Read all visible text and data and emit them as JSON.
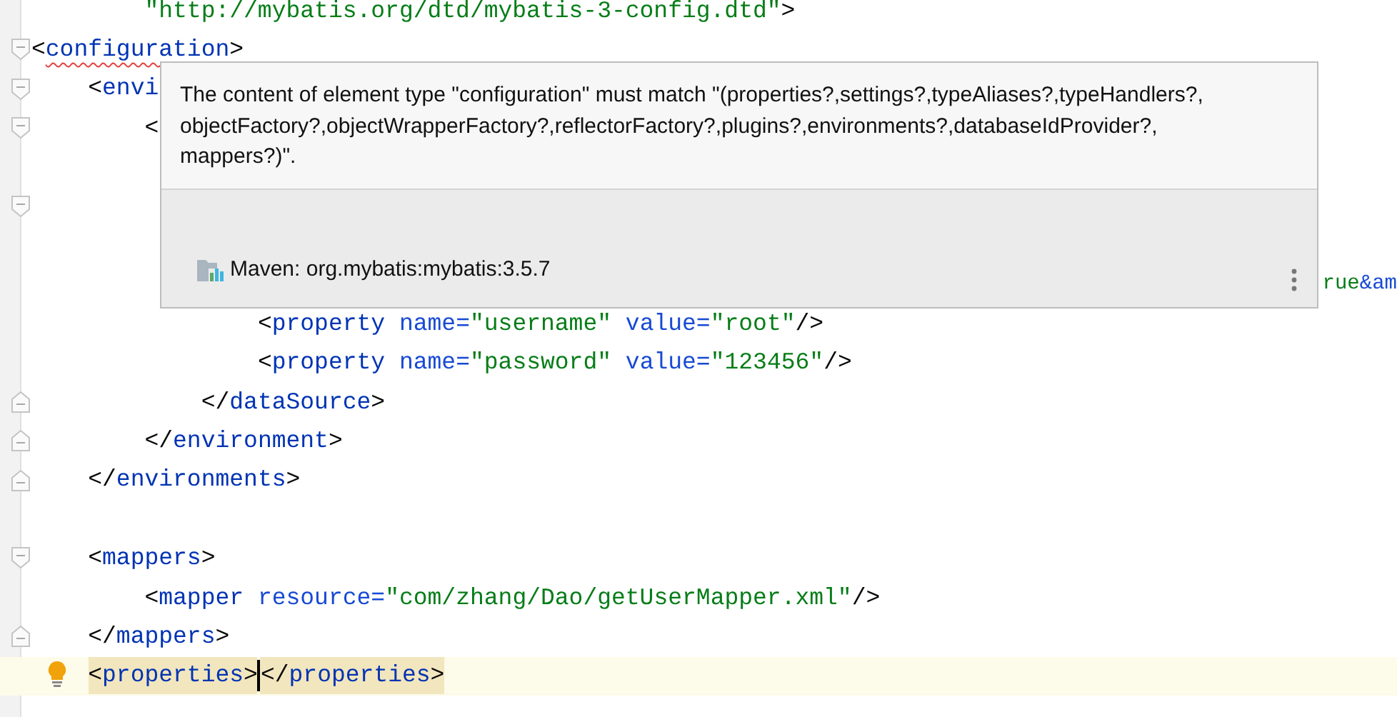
{
  "editor": {
    "lines": [
      {
        "kind": "plain",
        "tokens": [
          {
            "kind": "string",
            "text": "        \"http://mybatis.org/dtd/mybatis-3-config.dtd\""
          },
          {
            "kind": "bracket",
            "text": ">"
          }
        ]
      },
      {
        "kind": "fold-start",
        "tokens": [
          {
            "kind": "bracket",
            "text": "<"
          },
          {
            "kind": "error-tag",
            "text": "configuration"
          },
          {
            "kind": "bracket",
            "text": ">"
          }
        ]
      },
      {
        "kind": "fold-start",
        "tokens": [
          {
            "kind": "bracket",
            "text": "    <"
          },
          {
            "kind": "tag",
            "text": "envi"
          }
        ]
      },
      {
        "kind": "fold-start",
        "tokens": [
          {
            "kind": "bracket",
            "text": "        <"
          }
        ]
      },
      {
        "kind": "plain"
      },
      {
        "kind": "fold-start"
      },
      {
        "kind": "plain"
      },
      {
        "kind": "fragment",
        "tokens": [
          {
            "kind": "string",
            "text": "rue"
          },
          {
            "kind": "attr",
            "text": "&am"
          }
        ]
      },
      {
        "kind": "plain",
        "tokens": [
          {
            "kind": "bracket",
            "text": "                <"
          },
          {
            "kind": "tag",
            "text": "property"
          },
          {
            "kind": "attr",
            "text": " name="
          },
          {
            "kind": "string",
            "text": "\"username\""
          },
          {
            "kind": "attr",
            "text": " value="
          },
          {
            "kind": "string",
            "text": "\"root\""
          },
          {
            "kind": "bracket",
            "text": "/>"
          }
        ]
      },
      {
        "kind": "plain",
        "tokens": [
          {
            "kind": "bracket",
            "text": "                <"
          },
          {
            "kind": "tag",
            "text": "property"
          },
          {
            "kind": "attr",
            "text": " name="
          },
          {
            "kind": "string",
            "text": "\"password\""
          },
          {
            "kind": "attr",
            "text": " value="
          },
          {
            "kind": "string",
            "text": "\"123456\""
          },
          {
            "kind": "bracket",
            "text": "/>"
          }
        ]
      },
      {
        "kind": "fold-end",
        "tokens": [
          {
            "kind": "bracket",
            "text": "            </"
          },
          {
            "kind": "tag",
            "text": "dataSource"
          },
          {
            "kind": "bracket",
            "text": ">"
          }
        ]
      },
      {
        "kind": "fold-end",
        "tokens": [
          {
            "kind": "bracket",
            "text": "        </"
          },
          {
            "kind": "tag",
            "text": "environment"
          },
          {
            "kind": "bracket",
            "text": ">"
          }
        ]
      },
      {
        "kind": "fold-end",
        "tokens": [
          {
            "kind": "bracket",
            "text": "    </"
          },
          {
            "kind": "tag",
            "text": "environments"
          },
          {
            "kind": "bracket",
            "text": ">"
          }
        ]
      },
      {
        "kind": "plain"
      },
      {
        "kind": "fold-start",
        "tokens": [
          {
            "kind": "bracket",
            "text": "    <"
          },
          {
            "kind": "tag",
            "text": "mappers"
          },
          {
            "kind": "bracket",
            "text": ">"
          }
        ]
      },
      {
        "kind": "plain",
        "tokens": [
          {
            "kind": "bracket",
            "text": "        <"
          },
          {
            "kind": "tag",
            "text": "mapper"
          },
          {
            "kind": "attr",
            "text": " resource="
          },
          {
            "kind": "string",
            "text": "\"com/zhang/Dao/getUserMapper.xml\""
          },
          {
            "kind": "bracket",
            "text": "/>"
          }
        ]
      },
      {
        "kind": "fold-end",
        "tokens": [
          {
            "kind": "bracket",
            "text": "    </"
          },
          {
            "kind": "tag",
            "text": "mappers"
          },
          {
            "kind": "bracket",
            "text": ">"
          }
        ]
      },
      {
        "kind": "current",
        "before_caret": [
          {
            "kind": "bracket",
            "text": "<"
          },
          {
            "kind": "tag",
            "text": "properties"
          },
          {
            "kind": "bracket",
            "text": ">"
          }
        ],
        "after_caret": [
          {
            "kind": "bracket",
            "text": "</"
          },
          {
            "kind": "tag",
            "text": "properties"
          },
          {
            "kind": "bracket",
            "text": ">"
          }
        ]
      }
    ]
  },
  "popup": {
    "message": "The content of element type \"configuration\" must match \"(properties?,settings?,typeAliases?,typeHandlers?,objectFactory?,objectWrapperFactory?,reflectorFactory?,plugins?,environments?,databaseIdProvider?,mappers?)\".",
    "source": "Maven: org.mybatis:mybatis:3.5.7"
  }
}
